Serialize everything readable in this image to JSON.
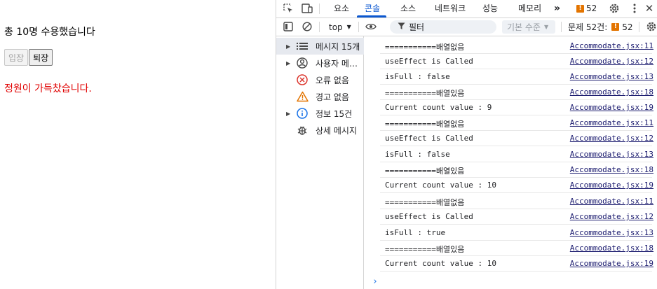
{
  "app": {
    "count_text": "총 10명 수용했습니다",
    "enter_button": "입장",
    "exit_button": "퇴장",
    "full_message": "정원이 가득찼습니다."
  },
  "devtools": {
    "tabs": [
      "요소",
      "콘솔",
      "소스",
      "네트워크",
      "성능",
      "메모리"
    ],
    "active_tab": "콘솔",
    "more_tabs": "»",
    "issues_badge": "52",
    "toolbar": {
      "context": "top",
      "filter_placeholder": "필터",
      "level": "기본 수준",
      "issues_label": "문제 52건:",
      "issues_count": "52"
    },
    "sidebar": [
      {
        "label": "메시지 15개",
        "icon": "list-icon",
        "expandable": true,
        "selected": true
      },
      {
        "label": "사용자 메시지",
        "icon": "user-icon",
        "expandable": true,
        "selected": false
      },
      {
        "label": "오류 없음",
        "icon": "error-icon",
        "expandable": false,
        "selected": false
      },
      {
        "label": "경고 없음",
        "icon": "warning-icon",
        "expandable": false,
        "selected": false
      },
      {
        "label": "정보 15건",
        "icon": "info-icon",
        "expandable": true,
        "selected": false
      },
      {
        "label": "상세 메시지",
        "icon": "bug-icon",
        "expandable": false,
        "selected": false
      }
    ],
    "console_rows": [
      {
        "message": "===========배열없음",
        "source": "Accommodate.jsx:11"
      },
      {
        "message": "useEffect is Called",
        "source": "Accommodate.jsx:12"
      },
      {
        "message": "isFull : false",
        "source": "Accommodate.jsx:13"
      },
      {
        "message": "===========배열있음",
        "source": "Accommodate.jsx:18"
      },
      {
        "message": "Current count value : 9",
        "source": "Accommodate.jsx:19"
      },
      {
        "message": "===========배열없음",
        "source": "Accommodate.jsx:11"
      },
      {
        "message": "useEffect is Called",
        "source": "Accommodate.jsx:12"
      },
      {
        "message": "isFull : false",
        "source": "Accommodate.jsx:13"
      },
      {
        "message": "===========배열있음",
        "source": "Accommodate.jsx:18"
      },
      {
        "message": "Current count value : 10",
        "source": "Accommodate.jsx:19"
      },
      {
        "message": "===========배열없음",
        "source": "Accommodate.jsx:11"
      },
      {
        "message": "useEffect is Called",
        "source": "Accommodate.jsx:12"
      },
      {
        "message": "isFull : true",
        "source": "Accommodate.jsx:13"
      },
      {
        "message": "===========배열있음",
        "source": "Accommodate.jsx:18"
      },
      {
        "message": "Current count value : 10",
        "source": "Accommodate.jsx:19"
      }
    ],
    "prompt": "›"
  }
}
